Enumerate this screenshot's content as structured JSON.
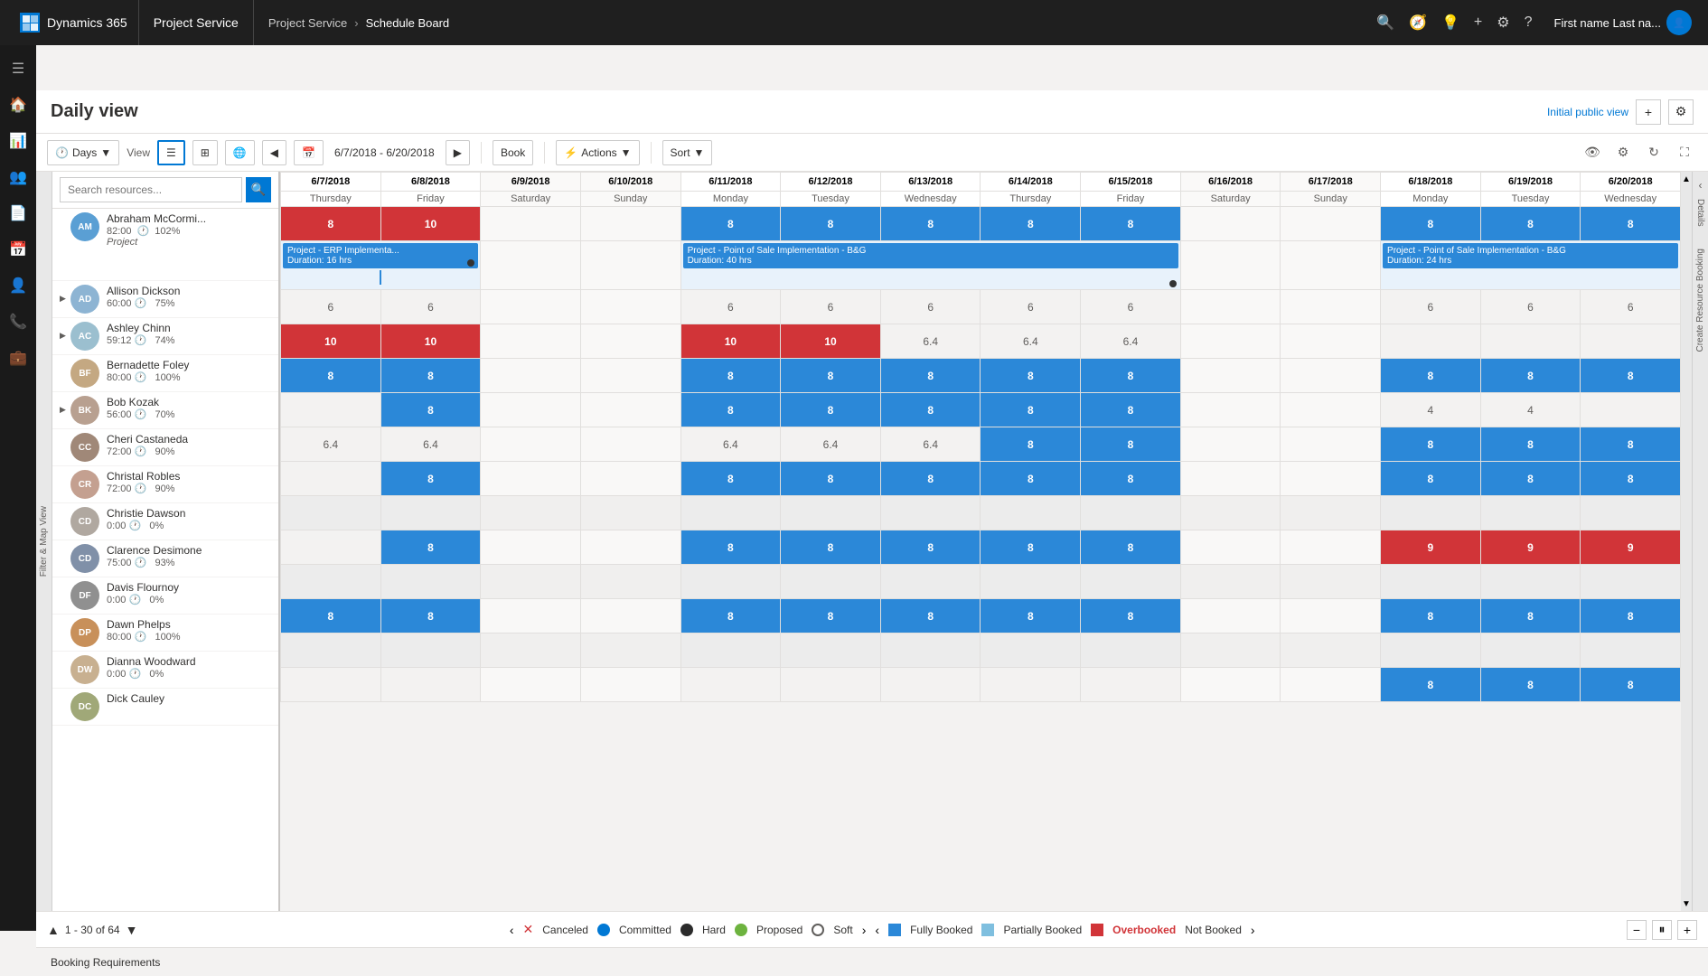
{
  "app": {
    "title": "Dynamics 365",
    "module": "Project Service",
    "breadcrumb": [
      "Project Service",
      "Schedule Board"
    ],
    "user": "First name Last na..."
  },
  "page": {
    "title": "Daily view",
    "initial_public_view": "Initial public view"
  },
  "toolbar": {
    "days_label": "Days",
    "view_label": "View",
    "date_range": "6/7/2018 - 6/20/2018",
    "book_label": "Book",
    "actions_label": "Actions",
    "sort_label": "Sort"
  },
  "search": {
    "placeholder": "Search resources..."
  },
  "dates": [
    {
      "date": "6/7/2018",
      "dow": "Thursday",
      "weekend": false
    },
    {
      "date": "6/8/2018",
      "dow": "Friday",
      "weekend": false
    },
    {
      "date": "6/9/2018",
      "dow": "Saturday",
      "weekend": true
    },
    {
      "date": "6/10/2018",
      "dow": "Sunday",
      "weekend": true
    },
    {
      "date": "6/11/2018",
      "dow": "Monday",
      "weekend": false
    },
    {
      "date": "6/12/2018",
      "dow": "Tuesday",
      "weekend": false
    },
    {
      "date": "6/13/2018",
      "dow": "Wednesday",
      "weekend": false
    },
    {
      "date": "6/14/2018",
      "dow": "Thursday",
      "weekend": false
    },
    {
      "date": "6/15/2018",
      "dow": "Friday",
      "weekend": false
    },
    {
      "date": "6/16/2018",
      "dow": "Saturday",
      "weekend": true
    },
    {
      "date": "6/17/2018",
      "dow": "Sunday",
      "weekend": true
    },
    {
      "date": "6/18/2018",
      "dow": "Monday",
      "weekend": false
    },
    {
      "date": "6/19/2018",
      "dow": "Tuesday",
      "weekend": false
    },
    {
      "date": "6/20/2018",
      "dow": "Wednesday",
      "weekend": false
    }
  ],
  "resources": [
    {
      "name": "Abraham McCormi...",
      "hours": "82:00",
      "util": "102%",
      "sub": "Project",
      "avatar_initials": "AM",
      "has_children": false,
      "cells": [
        "8b",
        "10r",
        "",
        "",
        "8b",
        "8b",
        "8b",
        "8b",
        "8b",
        "",
        "",
        "8b",
        "8b",
        "8b"
      ],
      "project1": {
        "name": "Project - ERP Implementa...",
        "duration": "Duration: 16 hrs",
        "start": 0,
        "span": 2
      },
      "project2": {
        "name": "Project - Point of Sale Implementation - B&G",
        "duration": "Duration: 40 hrs",
        "start": 4,
        "span": 5
      },
      "project3": {
        "name": "Project - Point of Sale Implementation - B&G",
        "duration": "Duration: 24 hrs",
        "start": 11,
        "span": 3
      }
    },
    {
      "name": "Allison Dickson",
      "hours": "60:00",
      "util": "75%",
      "avatar_initials": "AD",
      "has_children": true,
      "cells": [
        "6",
        "6",
        "",
        "",
        "6",
        "6",
        "6",
        "6",
        "6",
        "",
        "",
        "6",
        "6",
        "6"
      ]
    },
    {
      "name": "Ashley Chinn",
      "hours": "59:12",
      "util": "74%",
      "avatar_initials": "AC",
      "has_children": true,
      "cells": [
        "10r",
        "10r",
        "",
        "",
        "10r",
        "10r",
        "6.4",
        "6.4",
        "6.4",
        "",
        "",
        "",
        "",
        ""
      ]
    },
    {
      "name": "Bernadette Foley",
      "hours": "80:00",
      "util": "100%",
      "avatar_initials": "BF",
      "has_children": false,
      "cells": [
        "8b",
        "8b",
        "",
        "",
        "8b",
        "8b",
        "8b",
        "8b",
        "8b",
        "",
        "",
        "8b",
        "8b",
        "8b"
      ]
    },
    {
      "name": "Bob Kozak",
      "hours": "56:00",
      "util": "70%",
      "avatar_initials": "BK",
      "has_children": true,
      "cells": [
        "",
        "8b",
        "",
        "",
        "8b",
        "8b",
        "8b",
        "8b",
        "8b",
        "",
        "",
        "4",
        "4",
        ""
      ]
    },
    {
      "name": "Cheri Castaneda",
      "hours": "72:00",
      "util": "90%",
      "avatar_initials": "CC",
      "has_children": false,
      "cells": [
        "6.4",
        "6.4",
        "",
        "",
        "6.4",
        "6.4",
        "6.4",
        "8b",
        "8b",
        "",
        "",
        "8b",
        "8b",
        "8b"
      ]
    },
    {
      "name": "Christal Robles",
      "hours": "72:00",
      "util": "90%",
      "avatar_initials": "CR",
      "has_children": false,
      "cells": [
        "",
        "8b",
        "",
        "",
        "8b",
        "8b",
        "8b",
        "8b",
        "8b",
        "",
        "",
        "8b",
        "8b",
        "8b"
      ]
    },
    {
      "name": "Christie Dawson",
      "hours": "0:00",
      "util": "0%",
      "avatar_initials": "CD",
      "has_children": false,
      "cells": [
        "",
        "",
        "",
        "",
        "",
        "",
        "",
        "",
        "",
        "",
        "",
        "",
        "",
        ""
      ]
    },
    {
      "name": "Clarence Desimone",
      "hours": "75:00",
      "util": "93%",
      "avatar_initials": "CD2",
      "has_children": false,
      "cells": [
        "",
        "8b",
        "",
        "",
        "8b",
        "8b",
        "8b",
        "8b",
        "8b",
        "",
        "",
        "9r",
        "9r",
        "9r"
      ]
    },
    {
      "name": "Davis Flournoy",
      "hours": "0:00",
      "util": "0%",
      "avatar_initials": "DF",
      "has_children": false,
      "cells": [
        "",
        "",
        "",
        "",
        "",
        "",
        "",
        "",
        "",
        "",
        "",
        "",
        "",
        ""
      ]
    },
    {
      "name": "Dawn Phelps",
      "hours": "80:00",
      "util": "100%",
      "avatar_initials": "DP",
      "has_children": false,
      "cells": [
        "8b",
        "8b",
        "",
        "",
        "8b",
        "8b",
        "8b",
        "8b",
        "8b",
        "",
        "",
        "8b",
        "8b",
        "8b"
      ]
    },
    {
      "name": "Dianna Woodward",
      "hours": "0:00",
      "util": "0%",
      "avatar_initials": "DW",
      "has_children": false,
      "cells": [
        "",
        "",
        "",
        "",
        "",
        "",
        "",
        "",
        "",
        "",
        "",
        "",
        "",
        ""
      ]
    },
    {
      "name": "Dick Cauley",
      "hours": "",
      "util": "",
      "avatar_initials": "DC",
      "has_children": false,
      "cells": [
        "",
        "",
        "",
        "",
        "",
        "",
        "",
        "",
        "",
        "",
        "",
        "8b",
        "8b",
        "8b"
      ]
    }
  ],
  "pagination": {
    "text": "1 - 30 of 64"
  },
  "legend": [
    {
      "type": "x",
      "label": "Canceled"
    },
    {
      "type": "circle-blue",
      "label": "Committed"
    },
    {
      "type": "circle-dark",
      "label": "Hard"
    },
    {
      "type": "circle-green",
      "label": "Proposed"
    },
    {
      "type": "circle-outline",
      "label": "Soft"
    },
    {
      "type": "square-blue",
      "label": "Fully Booked"
    },
    {
      "type": "square-partial",
      "label": "Partially Booked"
    },
    {
      "type": "square-red",
      "label": "Overbooked"
    },
    {
      "type": "text",
      "label": "Not Booked"
    }
  ],
  "booking_requirements": "Booking Requirements",
  "details_label": "Details",
  "create_resource_label": "Create Resource Booking"
}
